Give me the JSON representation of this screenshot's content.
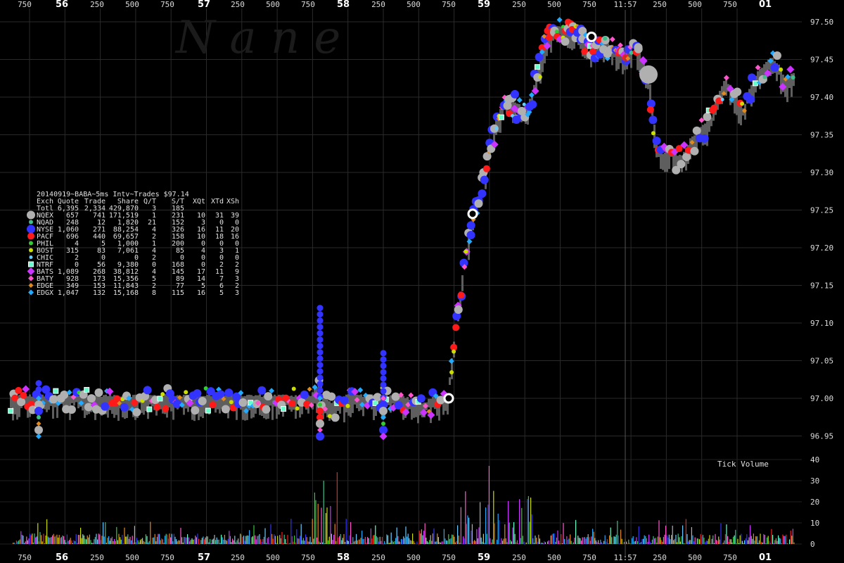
{
  "chart_data": {
    "type": "scatter",
    "title": "20140919~BABA~5ms Intv~Trades $97.14",
    "watermark": "N a n e",
    "price_axis": {
      "ylim": [
        96.91,
        97.525
      ],
      "ticks": [
        "97.50",
        "97.45",
        "97.40",
        "97.35",
        "97.30",
        "97.25",
        "97.20",
        "97.15",
        "97.10",
        "97.05",
        "97.00",
        "96.95"
      ]
    },
    "time_axis": {
      "labels": [
        "750",
        "56",
        "250",
        "500",
        "750",
        "57",
        "250",
        "500",
        "750",
        "58",
        "250",
        "500",
        "750",
        "59",
        "250",
        "500",
        "750",
        "11:57",
        "250",
        "500",
        "750",
        "01"
      ],
      "bold": [
        "56",
        "57",
        "58",
        "59",
        "01"
      ],
      "cursor_label": "11:57"
    },
    "volume_panel": {
      "title": "Tick Volume",
      "ylim": [
        0,
        40
      ],
      "ticks": [
        "40",
        "30",
        "20",
        "10",
        "0"
      ]
    },
    "legend": {
      "headers": [
        "Exch",
        "Quote",
        "Trade",
        "Share",
        "Q/T",
        "S/T",
        "XQt",
        "XTd",
        "XSh"
      ],
      "total": {
        "label": "Totl",
        "values": [
          "6,395",
          "2,334",
          "429,870",
          "3",
          "185",
          "",
          "",
          ""
        ]
      },
      "rows": [
        {
          "name": "NQEX",
          "color": "#b0b0b0",
          "shape": "circle-lg",
          "values": [
            "657",
            "741",
            "171,519",
            "1",
            "231",
            "10",
            "31",
            "39"
          ]
        },
        {
          "name": "NQAD",
          "color": "#3cc08a",
          "shape": "circle-sm",
          "values": [
            "248",
            "12",
            "1,820",
            "21",
            "152",
            "3",
            "0",
            "0"
          ]
        },
        {
          "name": "NYSE",
          "color": "#3333ff",
          "shape": "circle-lg",
          "values": [
            "1,060",
            "271",
            "88,254",
            "4",
            "326",
            "16",
            "11",
            "20"
          ]
        },
        {
          "name": "PACF",
          "color": "#ff1a1a",
          "shape": "circle-md",
          "values": [
            "696",
            "440",
            "69,657",
            "2",
            "158",
            "10",
            "18",
            "16"
          ]
        },
        {
          "name": "PHIL",
          "color": "#33cc33",
          "shape": "circle-sm",
          "values": [
            "4",
            "5",
            "1,000",
            "1",
            "200",
            "0",
            "0",
            "0"
          ]
        },
        {
          "name": "BOST",
          "color": "#ccdd00",
          "shape": "circle-sm",
          "values": [
            "315",
            "83",
            "7,061",
            "4",
            "85",
            "4",
            "3",
            "1"
          ]
        },
        {
          "name": "CHIC",
          "color": "#66ccff",
          "shape": "circle-xs",
          "values": [
            "2",
            "0",
            "0",
            "2",
            "0",
            "0",
            "0",
            "0"
          ]
        },
        {
          "name": "NTRF",
          "color": "#66ffcc",
          "shape": "square",
          "values": [
            "0",
            "56",
            "9,380",
            "0",
            "168",
            "0",
            "2",
            "2"
          ]
        },
        {
          "name": "BATS",
          "color": "#cc33ff",
          "shape": "diamond-lg",
          "values": [
            "1,089",
            "268",
            "38,812",
            "4",
            "145",
            "17",
            "11",
            "9"
          ]
        },
        {
          "name": "BATY",
          "color": "#ff55cc",
          "shape": "diamond",
          "values": [
            "928",
            "173",
            "15,356",
            "5",
            "89",
            "14",
            "7",
            "3"
          ]
        },
        {
          "name": "EDGE",
          "color": "#e08a1e",
          "shape": "diamond-sm",
          "values": [
            "349",
            "153",
            "11,843",
            "2",
            "77",
            "5",
            "6",
            "2"
          ]
        },
        {
          "name": "EDGX",
          "color": "#22aaff",
          "shape": "diamond",
          "values": [
            "1,047",
            "132",
            "15,168",
            "8",
            "115",
            "16",
            "5",
            "3"
          ]
        }
      ]
    },
    "price_path": [
      [
        0,
        97.0
      ],
      [
        60,
        97.0
      ],
      [
        140,
        97.0
      ],
      [
        210,
        97.0
      ],
      [
        260,
        97.0
      ],
      [
        320,
        97.0
      ],
      [
        370,
        97.0
      ],
      [
        410,
        97.0
      ],
      [
        440,
        97.0
      ],
      [
        455,
        97.02
      ],
      [
        458,
        97.0
      ],
      [
        470,
        96.99
      ],
      [
        490,
        97.0
      ],
      [
        530,
        97.0
      ],
      [
        570,
        97.0
      ],
      [
        600,
        96.99
      ],
      [
        620,
        97.0
      ],
      [
        635,
        97.0
      ],
      [
        640,
        97.04
      ],
      [
        645,
        97.08
      ],
      [
        650,
        97.12
      ],
      [
        655,
        97.15
      ],
      [
        660,
        97.19
      ],
      [
        667,
        97.22
      ],
      [
        675,
        97.25
      ],
      [
        685,
        97.29
      ],
      [
        695,
        97.33
      ],
      [
        705,
        97.37
      ],
      [
        715,
        97.39
      ],
      [
        730,
        97.39
      ],
      [
        745,
        97.38
      ],
      [
        755,
        97.4
      ],
      [
        765,
        97.44
      ],
      [
        775,
        97.48
      ],
      [
        790,
        97.49
      ],
      [
        810,
        97.49
      ],
      [
        830,
        97.48
      ],
      [
        845,
        97.46
      ],
      [
        860,
        97.47
      ],
      [
        875,
        97.46
      ],
      [
        890,
        97.46
      ],
      [
        900,
        97.47
      ],
      [
        915,
        97.44
      ],
      [
        922,
        97.42
      ],
      [
        926,
        97.39
      ],
      [
        930,
        97.35
      ],
      [
        935,
        97.33
      ],
      [
        940,
        97.32
      ],
      [
        950,
        97.33
      ],
      [
        960,
        97.32
      ],
      [
        970,
        97.32
      ],
      [
        980,
        97.34
      ],
      [
        990,
        97.35
      ],
      [
        1000,
        97.36
      ],
      [
        1010,
        97.37
      ],
      [
        1020,
        97.4
      ],
      [
        1030,
        97.42
      ],
      [
        1045,
        97.4
      ],
      [
        1055,
        97.38
      ],
      [
        1065,
        97.41
      ],
      [
        1075,
        97.43
      ],
      [
        1085,
        97.44
      ],
      [
        1095,
        97.45
      ],
      [
        1105,
        97.44
      ],
      [
        1115,
        97.42
      ],
      [
        1125,
        97.43
      ]
    ],
    "spikes": [
      [
        455,
        97.12
      ],
      [
        545,
        97.06
      ],
      [
        55,
        97.02
      ]
    ],
    "cursor_x": 889
  }
}
